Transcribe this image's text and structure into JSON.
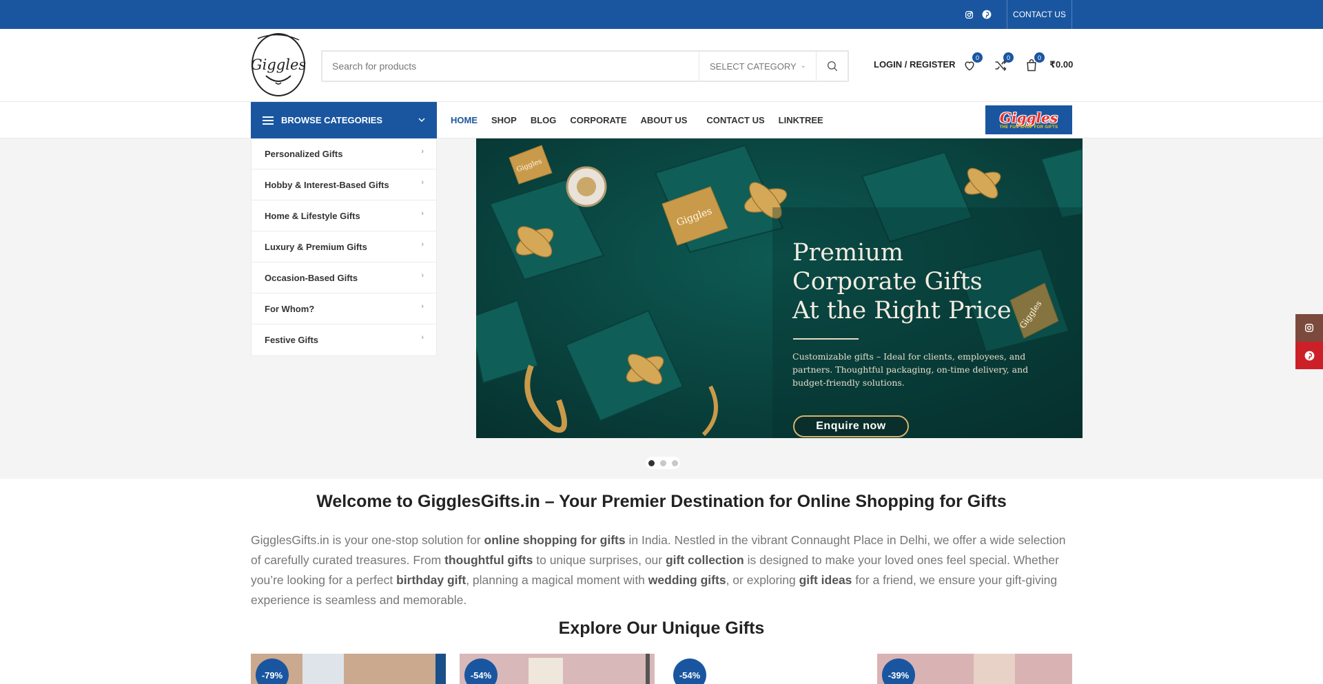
{
  "topbar": {
    "contact_label": "CONTACT US",
    "bg": "#1a56a0"
  },
  "header": {
    "search_placeholder": "Search for products",
    "category_label": "SELECT CATEGORY",
    "login_label": "LOGIN / REGISTER",
    "wishlist_count": "0",
    "compare_count": "0",
    "cart_count": "0",
    "cart_total": "₹0.00"
  },
  "nav": {
    "browse_label": "BROWSE CATEGORIES",
    "items": [
      "HOME",
      "SHOP",
      "BLOG",
      "CORPORATE",
      "ABOUT US",
      "CONTACT US",
      "LINKTREE"
    ],
    "banner_title": "Giggles",
    "banner_sub": "THE FUN SHOP FOR GIFTS"
  },
  "categories": [
    "Personalized Gifts",
    "Hobby & Interest-Based Gifts",
    "Home & Lifestyle Gifts",
    "Luxury & Premium Gifts",
    "Occasion-Based Gifts",
    "For Whom?",
    "Festive Gifts"
  ],
  "slide": {
    "title_lines": [
      "Premium",
      "Corporate Gifts",
      "At the Right Price"
    ],
    "text": "Customizable gifts – Ideal for clients, employees, and partners. Thoughtful packaging, on-time delivery, and budget-friendly solutions.",
    "button": "Enquire now",
    "box_label": "Giggles",
    "slide_count": 3,
    "active_slide": 1
  },
  "welcome": {
    "title": "Welcome to GigglesGifts.in – Your Premier Destination for Online Shopping for Gifts",
    "parts": [
      {
        "t": "GigglesGifts.in is your one-stop solution for ",
        "b": false
      },
      {
        "t": "online shopping for gifts",
        "b": true
      },
      {
        "t": " in India. Nestled in the vibrant Connaught Place in Delhi, we offer a wide selection of carefully curated treasures. From ",
        "b": false
      },
      {
        "t": "thoughtful gifts",
        "b": true
      },
      {
        "t": " to unique surprises, our ",
        "b": false
      },
      {
        "t": "gift collection",
        "b": true
      },
      {
        "t": " is designed to make your loved ones feel special. Whether you’re looking for a perfect ",
        "b": false
      },
      {
        "t": "birthday gift",
        "b": true
      },
      {
        "t": ", planning a magical moment with ",
        "b": false
      },
      {
        "t": "wedding gifts",
        "b": true
      },
      {
        "t": ", or exploring ",
        "b": false
      },
      {
        "t": "gift ideas",
        "b": true
      },
      {
        "t": " for a friend, we ensure your gift-giving experience is seamless and memorable.",
        "b": false
      }
    ]
  },
  "explore": {
    "title": "Explore Our Unique Gifts"
  },
  "products": [
    {
      "discount": "-79%"
    },
    {
      "discount": "-54%"
    },
    {
      "discount": "-54%"
    },
    {
      "discount": "-39%"
    }
  ],
  "colors": {
    "accent": "#1a56a0",
    "slide_bg": "#0b4a45",
    "gold": "#c99a4a",
    "instagram": "#7c4a3c",
    "pinterest": "#cb2027"
  }
}
